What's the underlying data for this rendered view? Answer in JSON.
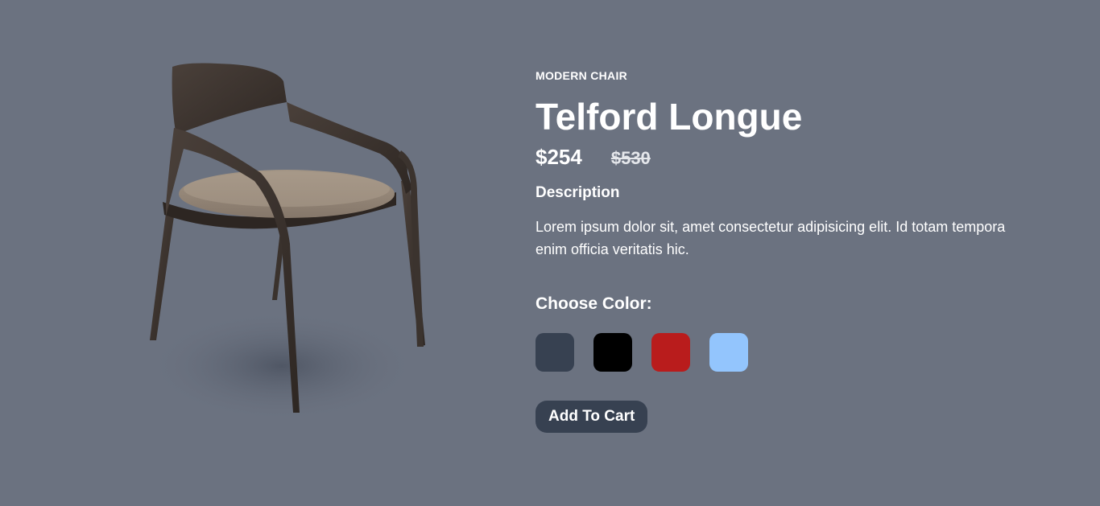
{
  "product": {
    "category": "MODERN CHAIR",
    "title": "Telford Longue",
    "price_current": "$254",
    "price_old": "$530",
    "description_heading": "Description",
    "description_text": "Lorem ipsum dolor sit, amet consectetur adipisicing elit. Id totam tempora enim officia veritatis hic.",
    "image_icon": "chair-product-image"
  },
  "colors": {
    "heading": "Choose Color:",
    "options": [
      {
        "name": "slate",
        "hex": "#374151"
      },
      {
        "name": "black",
        "hex": "#000000"
      },
      {
        "name": "red",
        "hex": "#b91c1c"
      },
      {
        "name": "light-blue",
        "hex": "#93c5fd"
      }
    ]
  },
  "actions": {
    "add_to_cart_label": "Add To Cart"
  },
  "theme": {
    "background": "#6b7280",
    "button_bg": "#374151"
  }
}
